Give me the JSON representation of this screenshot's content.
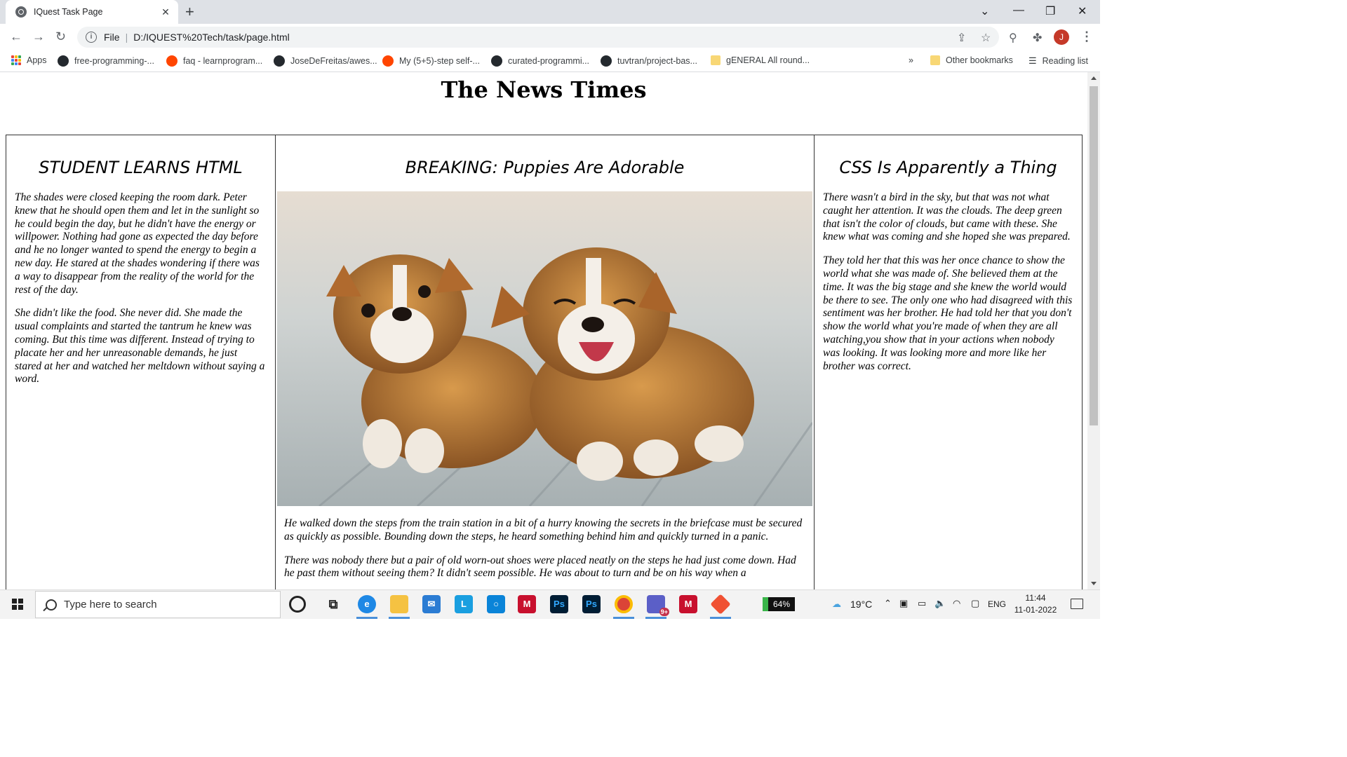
{
  "browser": {
    "tab_title": "IQuest Task Page",
    "tab_close": "✕",
    "new_tab": "+",
    "url_scheme_label": "File",
    "url": "D:/IQUEST%20Tech/task/page.html",
    "avatar_letter": "J",
    "bookmarks": [
      {
        "label": "Apps",
        "icon": "apps-grid-icon"
      },
      {
        "label": "free-programming-...",
        "icon": "github-icon"
      },
      {
        "label": "faq - learnprogram...",
        "icon": "reddit-icon"
      },
      {
        "label": "JoseDeFreitas/awes...",
        "icon": "github-icon"
      },
      {
        "label": "My (5+5)-step self-...",
        "icon": "reddit-icon"
      },
      {
        "label": "curated-programmi...",
        "icon": "github-icon"
      },
      {
        "label": "tuvtran/project-bas...",
        "icon": "github-icon"
      },
      {
        "label": "gENERAL All round...",
        "icon": "folder-icon"
      }
    ],
    "bookmarks_more": "»",
    "other_bookmarks": "Other bookmarks",
    "reading_list": "Reading list"
  },
  "page": {
    "masthead": "The News Times",
    "left": {
      "headline": "STUDENT LEARNS HTML",
      "paragraphs": [
        "The shades were closed keeping the room dark. Peter knew that he should open them and let in the sunlight so he could begin the day, but he didn't have the energy or willpower. Nothing had gone as expected the day before and he no longer wanted to spend the energy to begin a new day. He stared at the shades wondering if there was a way to disappear from the reality of the world for the rest of the day.",
        "She didn't like the food. She never did. She made the usual complaints and started the tantrum he knew was coming. But this time was different. Instead of trying to placate her and her unreasonable demands, he just stared at her and watched her meltdown without saying a word."
      ]
    },
    "middle": {
      "headline": "BREAKING: Puppies Are Adorable",
      "paragraphs": [
        "He walked down the steps from the train station in a bit of a hurry knowing the secrets in the briefcase must be secured as quickly as possible. Bounding down the steps, he heard something behind him and quickly turned in a panic.",
        "There was nobody there but a pair of old worn-out shoes were placed neatly on the steps he had just come down. Had he past them without seeing them? It didn't seem possible. He was about to turn and be on his way when a"
      ]
    },
    "right": {
      "headline": "CSS Is Apparently a Thing",
      "paragraphs": [
        "There wasn't a bird in the sky, but that was not what caught her attention. It was the clouds. The deep green that isn't the color of clouds, but came with these. She knew what was coming and she hoped she was prepared.",
        "They told her that this was her once chance to show the world what she was made of. She believed them at the time. It was the big stage and she knew the world would be there to see. The only one who had disagreed with this sentiment was her brother. He had told her that you don't show the world what you're made of when they are all watching,you show that in your actions when nobody was looking. It was looking more and more like her brother was correct."
      ]
    }
  },
  "taskbar": {
    "search_placeholder": "Type here to search",
    "battery": "64%",
    "temperature": "19°C",
    "language": "ENG",
    "time": "11:44",
    "date": "11-01-2022",
    "apps": [
      {
        "name": "cortana-icon"
      },
      {
        "name": "task-view-icon"
      },
      {
        "name": "edge-icon"
      },
      {
        "name": "file-explorer-icon"
      },
      {
        "name": "mail-icon"
      },
      {
        "name": "l-app-icon",
        "label": "L"
      },
      {
        "name": "blue-app-icon"
      },
      {
        "name": "mcafee-icon"
      },
      {
        "name": "photoshop-icon",
        "label": "Ps"
      },
      {
        "name": "photoshop-icon-2",
        "label": "Ps"
      },
      {
        "name": "chrome-icon"
      },
      {
        "name": "teams-icon",
        "badge": "9+"
      },
      {
        "name": "mcafee-icon-2"
      },
      {
        "name": "git-icon"
      }
    ]
  },
  "colors": {
    "chrome_bg": "#dee1e6",
    "avatar": "#c53929",
    "taskbar_bg": "#f3f3f3",
    "battery_green": "#3ab54a"
  }
}
